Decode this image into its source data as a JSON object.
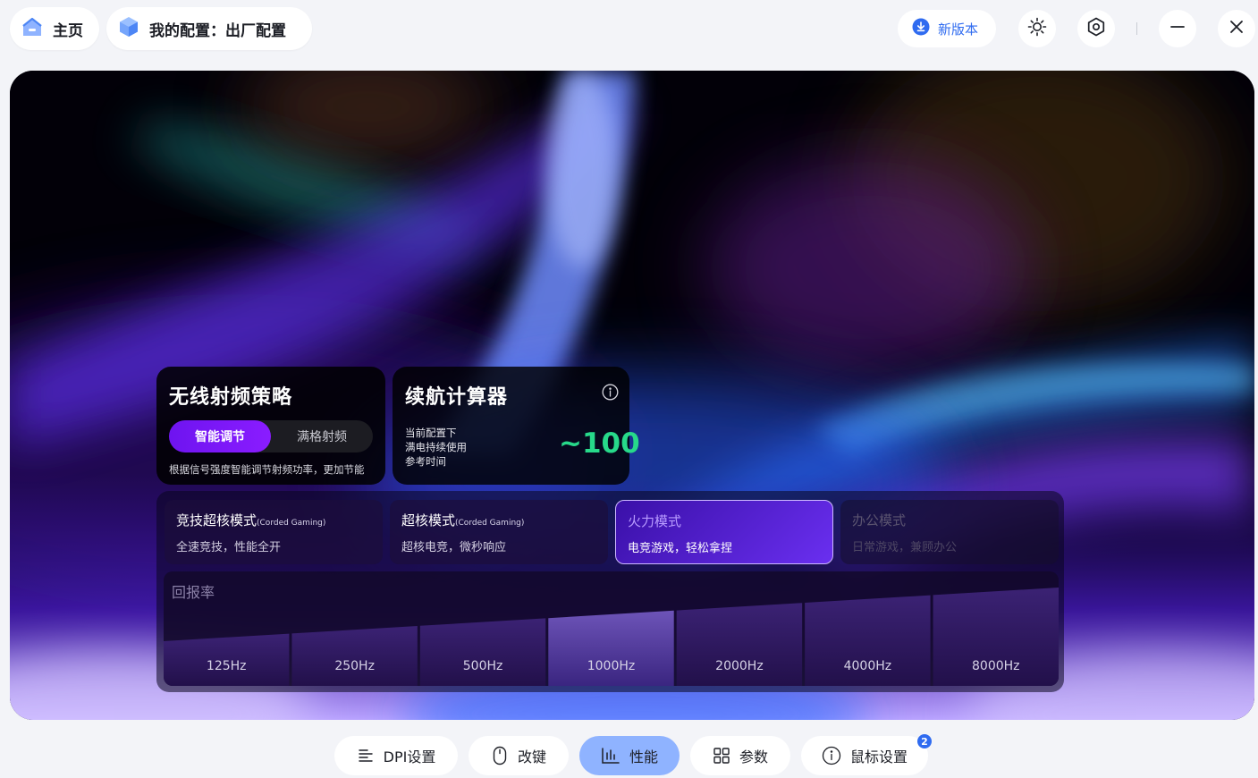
{
  "header": {
    "home_label": "主页",
    "config_label": "我的配置：出厂配置",
    "update_label": "新版本",
    "icons": [
      "home-icon",
      "cube-icon",
      "download-icon",
      "brightness-icon",
      "settings-icon",
      "minimize-icon",
      "close-icon"
    ]
  },
  "rf_card": {
    "title": "无线射频策略",
    "options": [
      "智能调节",
      "满格射频"
    ],
    "selected": "智能调节",
    "description": "根据信号强度智能调节射频功率，更加节能"
  },
  "battery_card": {
    "title": "续航计算器",
    "lines": [
      "当前配置下",
      "满电持续使用",
      "参考时间"
    ],
    "value": "~100",
    "value_color": "#27d98a"
  },
  "modes": [
    {
      "name": "竞技超核模式",
      "sub": "(Corded Gaming)",
      "desc": "全速竞技，性能全开",
      "state": "normal"
    },
    {
      "name": "超核模式",
      "sub": "(Corded Gaming)",
      "desc": "超核电竞，微秒响应",
      "state": "normal"
    },
    {
      "name": "火力模式",
      "sub": "",
      "desc": "电竞游戏，轻松拿捏",
      "state": "active"
    },
    {
      "name": "办公模式",
      "sub": "",
      "desc": "日常游戏，兼顾办公",
      "state": "disabled"
    }
  ],
  "polling_rate": {
    "title": "回报率",
    "options": [
      "125Hz",
      "250Hz",
      "500Hz",
      "1000Hz",
      "2000Hz",
      "4000Hz",
      "8000Hz"
    ],
    "selected": "1000Hz"
  },
  "bottom_tabs": [
    {
      "label": "DPI设置",
      "icon": "dpi-icon"
    },
    {
      "label": "改键",
      "icon": "mouse-icon"
    },
    {
      "label": "性能",
      "icon": "performance-icon",
      "active": true
    },
    {
      "label": "参数",
      "icon": "grid-icon"
    },
    {
      "label": "鼠标设置",
      "icon": "info-icon",
      "badge": "2"
    }
  ],
  "colors": {
    "accent": "#6e14f0",
    "tab_active": "#8fb3ff",
    "link_blue": "#2f6bf0"
  }
}
